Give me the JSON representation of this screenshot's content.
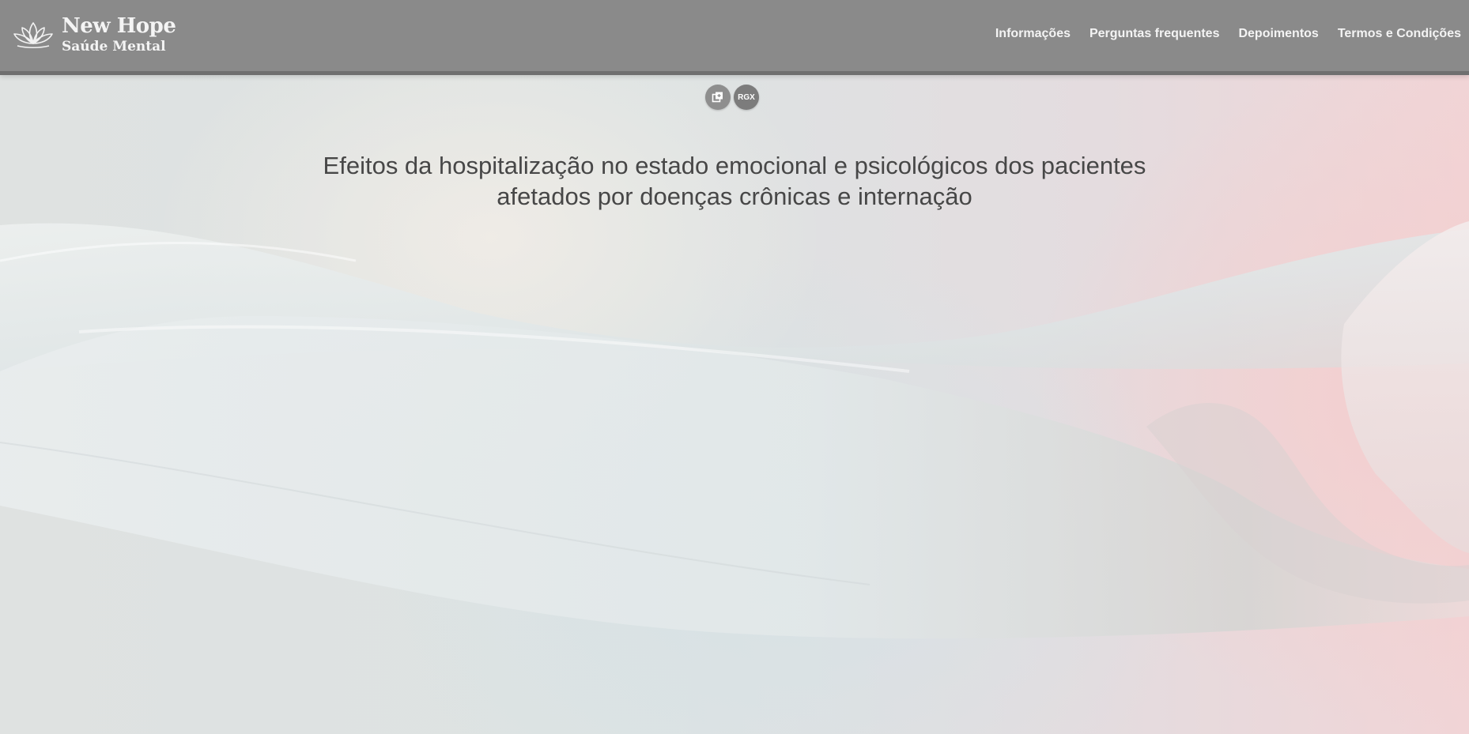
{
  "brand": {
    "title": "New Hope",
    "subtitle": "Saúde Mental",
    "logo_icon": "lotus-icon"
  },
  "nav": {
    "items": [
      {
        "label": "Informações"
      },
      {
        "label": "Perguntas frequentes"
      },
      {
        "label": "Depoimentos"
      },
      {
        "label": "Termos e Condições"
      }
    ]
  },
  "tools": {
    "copy_icon": "copy-icon",
    "rgx_label": "RGX"
  },
  "hero": {
    "line1": "Efeitos da hospitalização no estado emocional e psicológicos dos pacientes",
    "line2": "afetados por doenças crônicas e internação"
  },
  "colors": {
    "navbar": "#8a8a8a",
    "navbar_border": "#6f6f6f",
    "nav_text": "#f4f4f4",
    "headline_text": "#474747",
    "tool_button": "#8e8e8e"
  }
}
